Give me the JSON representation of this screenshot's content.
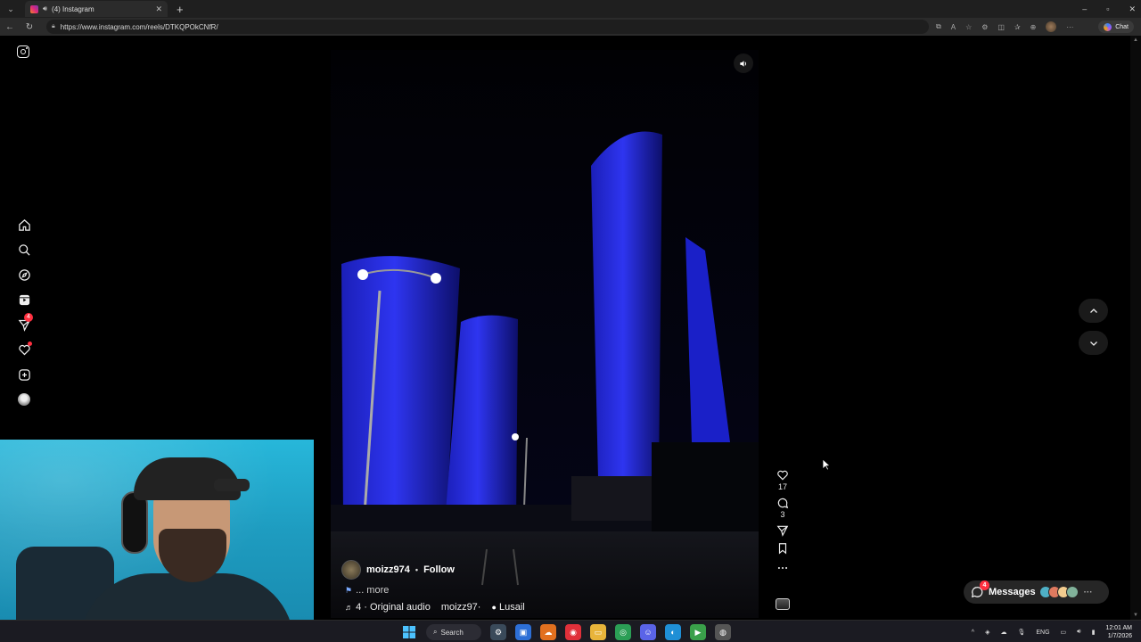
{
  "browser": {
    "tab": {
      "title": "(4) Instagram",
      "audio_icon": "speaker-icon"
    },
    "window_controls": {
      "minimize": "–",
      "restore": "▫",
      "close": "✕"
    },
    "url": "https://www.instagram.com/reels/DTKQPOkCNfR/",
    "chat_label": "Chat"
  },
  "sidebar": {
    "badge_messages": "4",
    "items": [
      "home",
      "search",
      "explore",
      "reels",
      "messages",
      "notifications",
      "create",
      "profile"
    ]
  },
  "reel": {
    "username": "moizz974",
    "separator": "•",
    "follow_label": "Follow",
    "caption_more": "... more",
    "audio_prefix": "4 ·",
    "audio_label": "Original audio",
    "audio_user": "moizz97·",
    "location": "Lusail",
    "likes": "17",
    "comments": "3"
  },
  "messages": {
    "label": "Messages",
    "badge": "4",
    "avatar_colors": [
      "#4fb0c6",
      "#e07a5f",
      "#f2cc8f",
      "#81b29a"
    ]
  },
  "taskbar": {
    "search_label": "Search",
    "language": "ENG",
    "time": "12:01 AM",
    "date": "1/7/2026"
  },
  "colors": {
    "accent_badge": "#ff3040",
    "building_blue": "#2a2ee0",
    "background": "#000000"
  }
}
